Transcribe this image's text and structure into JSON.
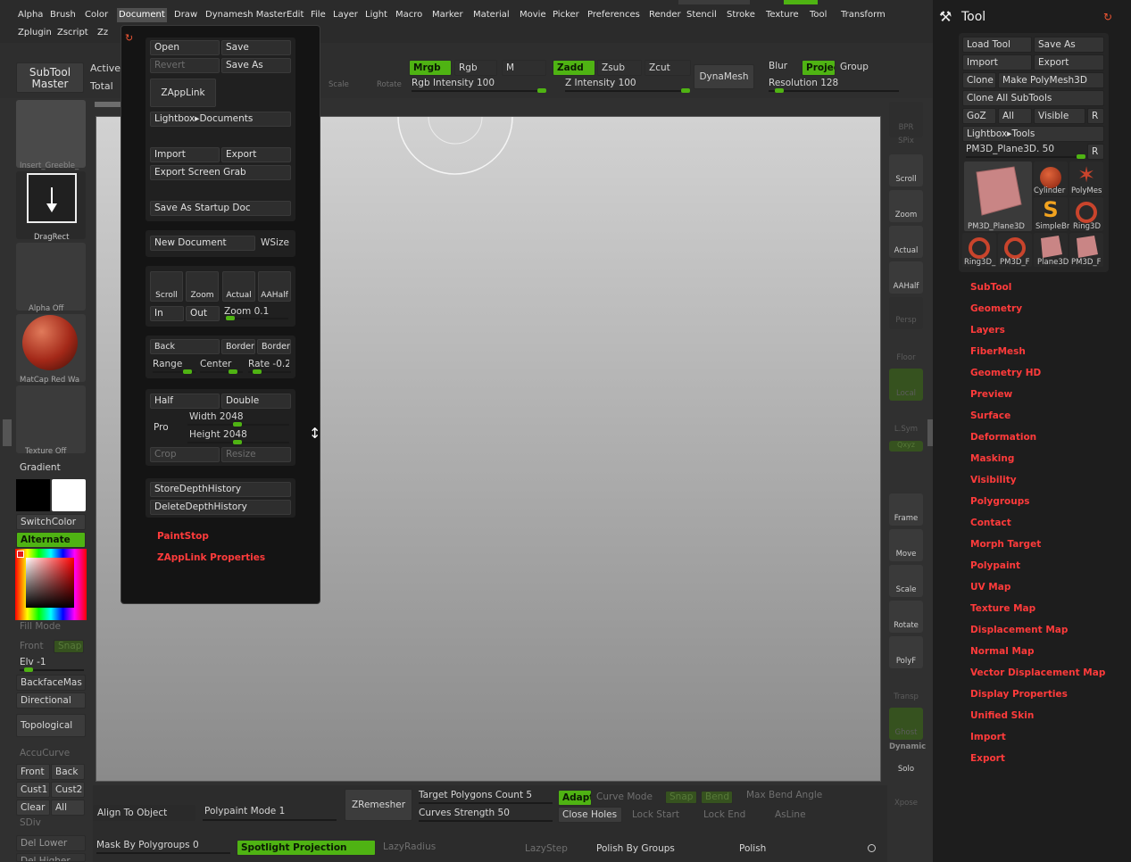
{
  "menubar": {
    "row1": [
      "Alpha",
      "Brush",
      "Color",
      "Document",
      "Draw",
      "Dynamesh Master",
      "Edit",
      "File",
      "Layer",
      "Light",
      "Macro",
      "Marker",
      "Material",
      "Movie",
      "Picker",
      "Preferences",
      "Render",
      "Stencil",
      "Stroke",
      "Texture",
      "Tool",
      "Transform"
    ],
    "row2": [
      "Zplugin",
      "Zscript",
      "Zz"
    ]
  },
  "top_shelf": {
    "subtool_master": "SubTool Master",
    "active": "Active",
    "total": "Total",
    "mrgb": "Mrgb",
    "rgb": "Rgb",
    "m": "M",
    "zadd": "Zadd",
    "zsub": "Zsub",
    "zcut": "Zcut",
    "rgb_intensity": "Rgb Intensity 100",
    "z_intensity": "Z Intensity 100",
    "dynamesh": "DynaMesh",
    "blur": "Blur",
    "project": "Projec",
    "group": "Group",
    "resolution": "Resolution 128",
    "scale": "Scale",
    "rotate": "Rotate"
  },
  "document_menu": {
    "open": "Open",
    "save": "Save",
    "revert": "Revert",
    "save_as": "Save As",
    "zapplink": "ZAppLink",
    "lightbox_documents": "Lightbox▸Documents",
    "import": "Import",
    "export": "Export",
    "export_screen_grab": "Export Screen Grab",
    "save_as_startup_doc": "Save As Startup Doc",
    "new_document": "New Document",
    "wsize": "WSize",
    "scroll": "Scroll",
    "zoom": "Zoom",
    "actual": "Actual",
    "aahalf": "AAHalf",
    "in": "In",
    "out": "Out",
    "zoom_value": "Zoom 0.1",
    "back": "Back",
    "border": "Border",
    "border2": "Border2",
    "range": "Range",
    "center": "Center",
    "rate": "Rate -0.2",
    "half": "Half",
    "double": "Double",
    "pro": "Pro",
    "width": "Width 2048",
    "height": "Height 2048",
    "crop": "Crop",
    "resize": "Resize",
    "store_depth_history": "StoreDepthHistory",
    "delete_depth_history": "DeleteDepthHistory",
    "paintstop": "PaintStop",
    "zapplink_properties": "ZAppLink Properties"
  },
  "left_panel": {
    "insert_label": "Insert_Greeble_",
    "dragrect": "DragRect",
    "alpha_off": "Alpha  Off",
    "matcap": "MatCap  Red  Wa",
    "texture_off": "Texture  Off",
    "gradient": "Gradient",
    "switchcolor": "SwitchColor",
    "alternate": "Alternate",
    "fill_mode": "Fill  Mode",
    "front": "Front",
    "snap": "Snap",
    "elv": "Elv  -1",
    "backfacemask": "BackfaceMas",
    "directional": "Directional",
    "topological": "Topological",
    "accucurve": "AccuCurve",
    "front2": "Front",
    "back2": "Back",
    "cust1": "Cust1",
    "cust2": "Cust2",
    "clear": "Clear",
    "all": "All",
    "sdiv": "SDiv",
    "del_lower": "Del Lower",
    "del_higher": "Del Higher"
  },
  "right_shelf": {
    "bpr": "BPR",
    "spix": "SPix",
    "scroll": "Scroll",
    "zoom": "Zoom",
    "actual": "Actual",
    "aahalf": "AAHalf",
    "persp": "Persp",
    "floor": "Floor",
    "local": "Local",
    "lsym": "L.Sym",
    "xyz": "Qxyz",
    "frame": "Frame",
    "move": "Move",
    "scale": "Scale",
    "rotate": "Rotate",
    "polyf": "PolyF",
    "transp": "Transp",
    "ghost": "Ghost",
    "dynamic": "Dynamic",
    "solo": "Solo",
    "xpose": "Xpose"
  },
  "bottom": {
    "align_to_object": "Align To Object",
    "polypaint_mode": "Polypaint Mode 1",
    "zremesher": "ZRemesher",
    "target_polygons": "Target Polygons Count 5",
    "curves_strength": "Curves Strength 50",
    "adapt": "Adapt",
    "curve_mode": "Curve Mode",
    "snap": "Snap",
    "bend": "Bend",
    "max_bend_angle": "Max Bend Angle",
    "close_holes": "Close Holes",
    "lock_start": "Lock Start",
    "lock_end": "Lock End",
    "asline": "AsLine",
    "mask_by_polygroups": "Mask By Polygroups 0",
    "spotlight_projection": "Spotlight Projection",
    "lazyradius": "LazyRadius",
    "lazystep": "LazyStep",
    "polish_by_groups": "Polish By Groups",
    "polish": "Polish"
  },
  "tool_panel": {
    "title": "Tool",
    "load_tool": "Load Tool",
    "save_as": "Save As",
    "import": "Import",
    "export": "Export",
    "clone": "Clone",
    "make_polymesh": "Make PolyMesh3D",
    "clone_all_subtools": "Clone All SubTools",
    "goz": "GoZ",
    "all": "All",
    "visible": "Visible",
    "r": "R",
    "lightbox_tools": "Lightbox▸Tools",
    "current_tool": "PM3D_Plane3D. 50",
    "thumbs": [
      "PM3D_Plane3D",
      "Cylinder",
      "PolyMes",
      "SimpleBr",
      "Ring3D",
      "Ring3D_",
      "PM3D_F",
      "Plane3D",
      "PM3D_F"
    ],
    "subpalettes": [
      "SubTool",
      "Geometry",
      "Layers",
      "FiberMesh",
      "Geometry HD",
      "Preview",
      "Surface",
      "Deformation",
      "Masking",
      "Visibility",
      "Polygroups",
      "Contact",
      "Morph Target",
      "Polypaint",
      "UV Map",
      "Texture Map",
      "Displacement Map",
      "Normal Map",
      "Vector Displacement Map",
      "Display Properties",
      "Unified Skin",
      "Import",
      "Export"
    ]
  },
  "colors": {
    "accent_green": "#4fb313",
    "red_label": "#ff3b3b"
  }
}
